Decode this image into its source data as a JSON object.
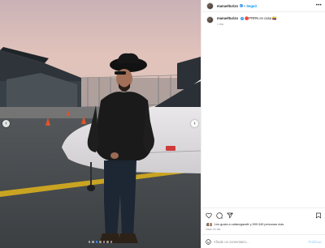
{
  "post": {
    "username": "manuelturizo",
    "separator": "•",
    "follow_label": "Seguir",
    "more_label": "•••",
    "caption_text": "🔴PRRN en casa 🇨🇴",
    "caption_time": "1 día"
  },
  "media": {
    "prev_label": "‹",
    "next_label": "›",
    "slide_count": 7,
    "active_slide": 2
  },
  "actions": {
    "liked_by_text": "Les gusta a cafaezgarafé y 599.349 personas más",
    "time": "Hace un día"
  },
  "comment": {
    "placeholder": "Añade un comentario...",
    "publish_label": "Publicar"
  },
  "colors": {
    "accent": "#0095f6",
    "verified": "#3897f0"
  },
  "icons": [
    "heart-icon",
    "comment-icon",
    "share-icon",
    "bookmark-icon",
    "emoji-icon",
    "verified-icon",
    "more-icon"
  ]
}
